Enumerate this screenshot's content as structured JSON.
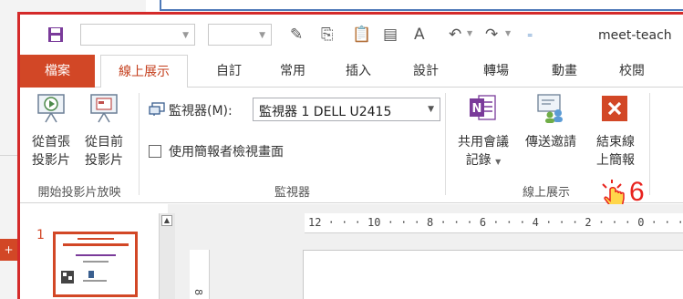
{
  "window": {
    "doc_title": "meet-teach"
  },
  "tabs": [
    {
      "label": "檔案"
    },
    {
      "label": "線上展示"
    },
    {
      "label": "自訂"
    },
    {
      "label": "常用"
    },
    {
      "label": "插入"
    },
    {
      "label": "設計"
    },
    {
      "label": "轉場"
    },
    {
      "label": "動畫"
    },
    {
      "label": "校閱"
    }
  ],
  "ribbon": {
    "start_group": {
      "label": "開始投影片放映",
      "from_beginning": {
        "line1": "從首張",
        "line2": "投影片"
      },
      "from_current": {
        "line1": "從目前",
        "line2": "投影片"
      }
    },
    "monitor_group": {
      "label": "監視器",
      "monitor_label": "監視器(M):",
      "monitor_value": "監視器 1 DELL U2415",
      "presenter_view_label": "使用簡報者檢視畫面"
    },
    "online_group": {
      "label": "線上展示",
      "share_notes": {
        "line1": "共用會議",
        "line2": "記錄"
      },
      "send_invite": {
        "line1": "傳送邀請"
      },
      "end_online": {
        "line1": "結束線",
        "line2": "上簡報"
      }
    }
  },
  "annotation": {
    "step_number": "6"
  },
  "slides": {
    "slide_number": "1"
  },
  "ruler": {
    "top_ticks": "12 · · · 10 · · · 8 · · · 6 · · · 4 · · · 2 · · · 0 · · · 2",
    "left_tick": "8"
  },
  "colors": {
    "accent": "#d24726",
    "highlight_frame": "#d42a2a",
    "annotation": "#e8231f"
  }
}
